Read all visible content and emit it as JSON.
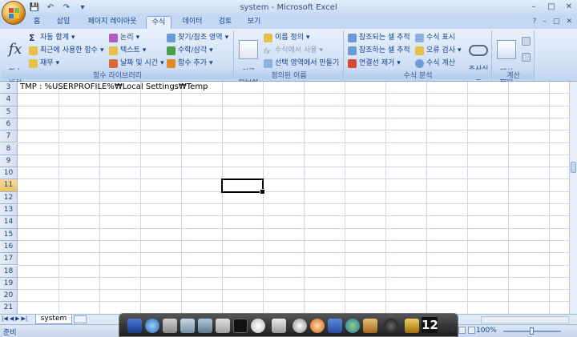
{
  "window": {
    "title": "system - Microsoft Excel"
  },
  "tabs": [
    {
      "label": "홈"
    },
    {
      "label": "삽입"
    },
    {
      "label": "페이지 레이아웃"
    },
    {
      "label": "수식",
      "active": true
    },
    {
      "label": "데이터"
    },
    {
      "label": "검토"
    },
    {
      "label": "보기"
    }
  ],
  "ribbon": {
    "function_library": {
      "label": "함수 라이브러리",
      "insert_function": "함수\n삽입",
      "autosum": "자동 합계",
      "recently_used": "최근에 사용한 함수",
      "financial": "재무",
      "logical": "논리",
      "text": "텍스트",
      "date_time": "날짜 및 시간",
      "lookup_ref": "찾기/참조 영역",
      "math_trig": "수학/삼각",
      "more_functions": "함수 추가"
    },
    "defined_names": {
      "label": "정의된 이름",
      "name_manager": "이름\n관리자",
      "define_name": "이름 정의",
      "use_in_formula": "수식에서 사용",
      "create_from_selection": "선택 영역에서 만들기"
    },
    "formula_auditing": {
      "label": "수식 분석",
      "trace_precedents": "참조되는 셀 추적",
      "trace_dependents": "참조하는 셀 추적",
      "remove_arrows": "연결선 제거",
      "show_formulas": "수식 표시",
      "error_checking": "오류 검사",
      "evaluate_formula": "수식 계산",
      "watch_window": "조사식\n창"
    },
    "calculation": {
      "label": "계산",
      "options": "계산\n옵션"
    }
  },
  "sheet": {
    "rows": [
      "3",
      "4",
      "5",
      "6",
      "7",
      "8",
      "9",
      "10",
      "11",
      "12",
      "13",
      "14",
      "15",
      "16",
      "17",
      "18",
      "19",
      "20",
      "21"
    ],
    "selected_row": "11",
    "row3_text": "TMP  : %USERPROFILE%₩Local Settings₩Temp"
  },
  "sheet_tabs": {
    "active": "system"
  },
  "status": {
    "mode": "준비",
    "zoom": "100%"
  },
  "dock": {
    "badge": "12"
  },
  "colors": {
    "ribbon_bg": "#d3e2f6",
    "accent_text": "#15428b",
    "selection": "#f1c15f"
  }
}
